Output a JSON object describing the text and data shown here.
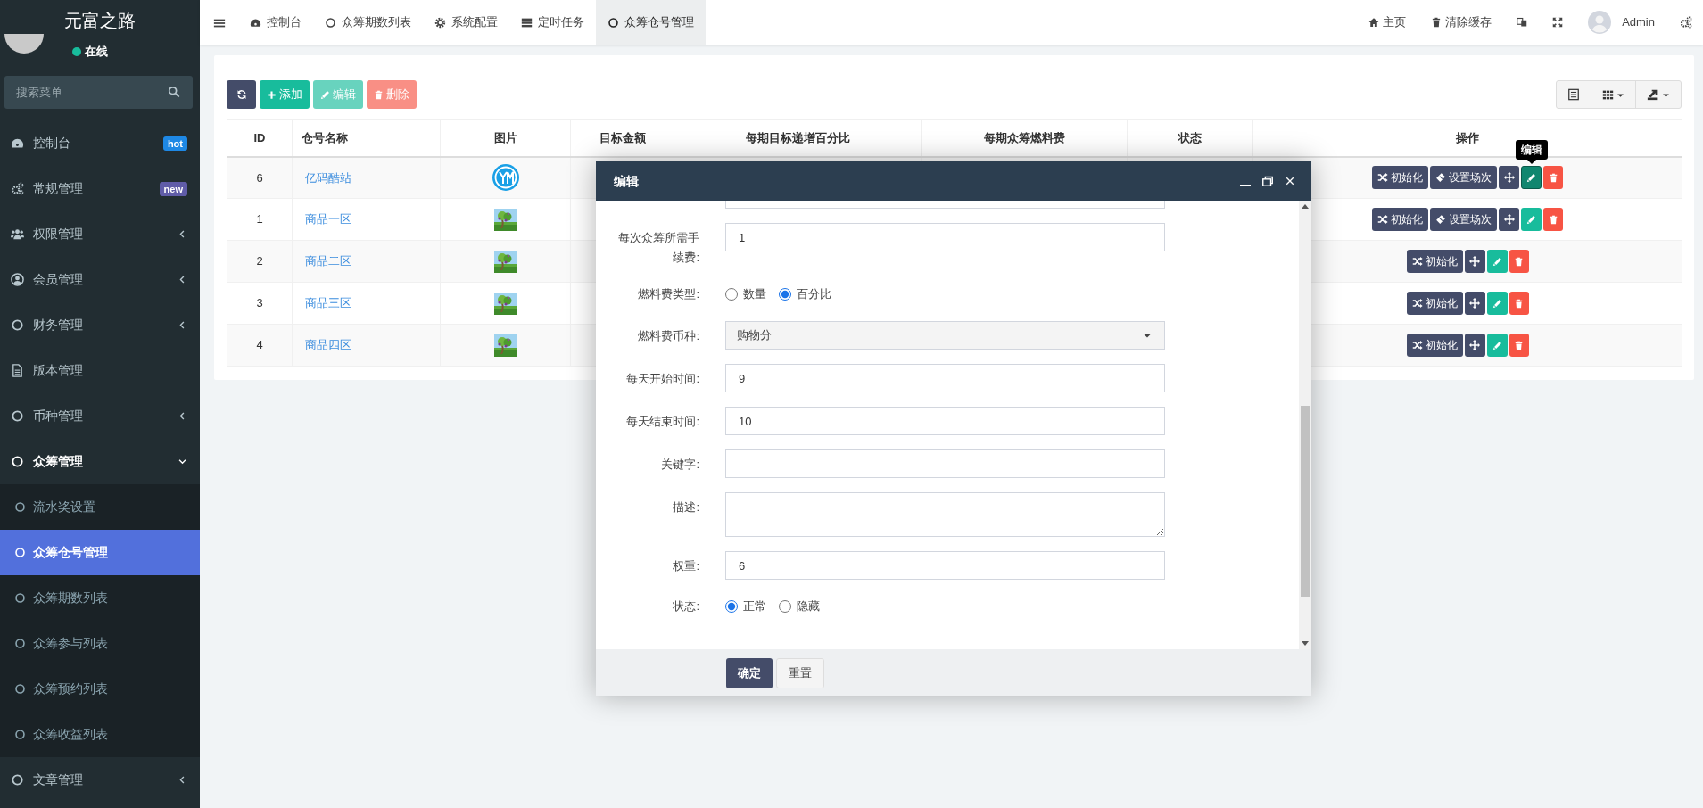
{
  "sidebar": {
    "brand": "元富之路",
    "user": {
      "status": "在线",
      "online": true
    },
    "search": {
      "placeholder": "搜索菜单"
    },
    "menu": [
      {
        "label": "控制台",
        "badge": {
          "text": "hot",
          "color": "#1e88e5"
        }
      },
      {
        "label": "常规管理",
        "badge": {
          "text": "new",
          "color": "#605ca8"
        }
      },
      {
        "label": "权限管理",
        "expanded": false
      },
      {
        "label": "会员管理",
        "expanded": false
      },
      {
        "label": "财务管理",
        "expanded": false
      },
      {
        "label": "版本管理"
      },
      {
        "label": "币种管理",
        "expanded": false
      },
      {
        "label": "众筹管理",
        "expanded": true,
        "children": [
          {
            "label": "流水奖设置",
            "selected": false
          },
          {
            "label": "众筹仓号管理",
            "selected": true
          },
          {
            "label": "众筹期数列表",
            "selected": false
          },
          {
            "label": "众筹参与列表",
            "selected": false
          },
          {
            "label": "众筹预约列表",
            "selected": false
          },
          {
            "label": "众筹收益列表",
            "selected": false
          }
        ]
      },
      {
        "label": "文章管理",
        "expanded": false
      }
    ]
  },
  "tabs": [
    {
      "label": "控制台",
      "selected": false
    },
    {
      "label": "众筹期数列表",
      "selected": false
    },
    {
      "label": "系统配置",
      "selected": false
    },
    {
      "label": "定时任务",
      "selected": false
    },
    {
      "label": "众筹仓号管理",
      "selected": true
    }
  ],
  "right_nav": [
    {
      "kind": "home",
      "label": "主页"
    },
    {
      "kind": "clear-cache",
      "label": "清除缓存"
    },
    {
      "kind": "translate"
    },
    {
      "kind": "fullscreen"
    },
    {
      "kind": "user",
      "label": "Admin"
    },
    {
      "kind": "settings"
    }
  ],
  "toolbar": {
    "buttons": [
      {
        "kind": "refresh",
        "disabled": false
      },
      {
        "kind": "add",
        "label": "添加",
        "disabled": false
      },
      {
        "kind": "edit",
        "label": "编辑",
        "disabled": true
      },
      {
        "kind": "delete",
        "label": "删除",
        "disabled": true
      }
    ],
    "tools": [
      {
        "kind": "view"
      },
      {
        "kind": "columns"
      },
      {
        "kind": "export"
      }
    ]
  },
  "table": {
    "columns": [
      "ID",
      "仓号名称",
      "图片",
      "目标金额",
      "每期目标递增百分比",
      "每期众筹燃料费",
      "状态",
      "操作"
    ],
    "rows": [
      {
        "id": "6",
        "name": "亿码酷站",
        "image": {
          "kind": "logo"
        },
        "actions": [
          {
            "kind": "init",
            "label": "初始化",
            "hovered": false
          },
          {
            "kind": "schedule",
            "label": "设置场次",
            "hovered": false
          },
          {
            "kind": "move",
            "hovered": false
          },
          {
            "kind": "edit",
            "hovered": true,
            "tooltip": "编辑"
          },
          {
            "kind": "delete",
            "hovered": false
          }
        ]
      },
      {
        "id": "1",
        "name": "商品一区",
        "image": {
          "kind": "picture"
        },
        "actions": [
          {
            "kind": "init",
            "label": "初始化",
            "hovered": false
          },
          {
            "kind": "schedule",
            "label": "设置场次",
            "hovered": false
          },
          {
            "kind": "move",
            "hovered": false
          },
          {
            "kind": "edit",
            "hovered": false
          },
          {
            "kind": "delete",
            "hovered": false
          }
        ]
      },
      {
        "id": "2",
        "name": "商品二区",
        "image": {
          "kind": "picture"
        },
        "actions": [
          {
            "kind": "init",
            "label": "初始化",
            "hovered": false
          },
          {
            "kind": "move",
            "hovered": false
          },
          {
            "kind": "edit",
            "hovered": false
          },
          {
            "kind": "delete",
            "hovered": false
          }
        ]
      },
      {
        "id": "3",
        "name": "商品三区",
        "image": {
          "kind": "picture"
        },
        "actions": [
          {
            "kind": "init",
            "label": "初始化",
            "hovered": false
          },
          {
            "kind": "move",
            "hovered": false
          },
          {
            "kind": "edit",
            "hovered": false
          },
          {
            "kind": "delete",
            "hovered": false
          }
        ]
      },
      {
        "id": "4",
        "name": "商品四区",
        "image": {
          "kind": "picture"
        },
        "actions": [
          {
            "kind": "init",
            "label": "初始化",
            "hovered": false
          },
          {
            "kind": "move",
            "hovered": false
          },
          {
            "kind": "edit",
            "hovered": false
          },
          {
            "kind": "delete",
            "hovered": false
          }
        ]
      }
    ]
  },
  "modal": {
    "title": "编辑",
    "fields": [
      {
        "kind": "text"
      },
      {
        "kind": "text",
        "label": "每次众筹所需手续费:",
        "value": "1"
      },
      {
        "kind": "radio",
        "label": "燃料费类型:",
        "options": [
          {
            "label": "数量",
            "selected": false
          },
          {
            "label": "百分比",
            "selected": true
          }
        ]
      },
      {
        "kind": "select",
        "label": "燃料费币种:",
        "value": "购物分"
      },
      {
        "kind": "text",
        "label": "每天开始时间:",
        "value": "9"
      },
      {
        "kind": "text",
        "label": "每天结束时间:",
        "value": "10"
      },
      {
        "kind": "text",
        "label": "关键字:"
      },
      {
        "kind": "textarea",
        "label": "描述:"
      },
      {
        "kind": "text",
        "label": "权重:",
        "value": "6"
      },
      {
        "kind": "radio",
        "label": "状态:",
        "options": [
          {
            "label": "正常",
            "selected": true
          },
          {
            "label": "隐藏",
            "selected": false
          }
        ]
      }
    ],
    "buttons": [
      {
        "kind": "primary",
        "label": "确定"
      },
      {
        "kind": "default",
        "label": "重置"
      }
    ]
  }
}
